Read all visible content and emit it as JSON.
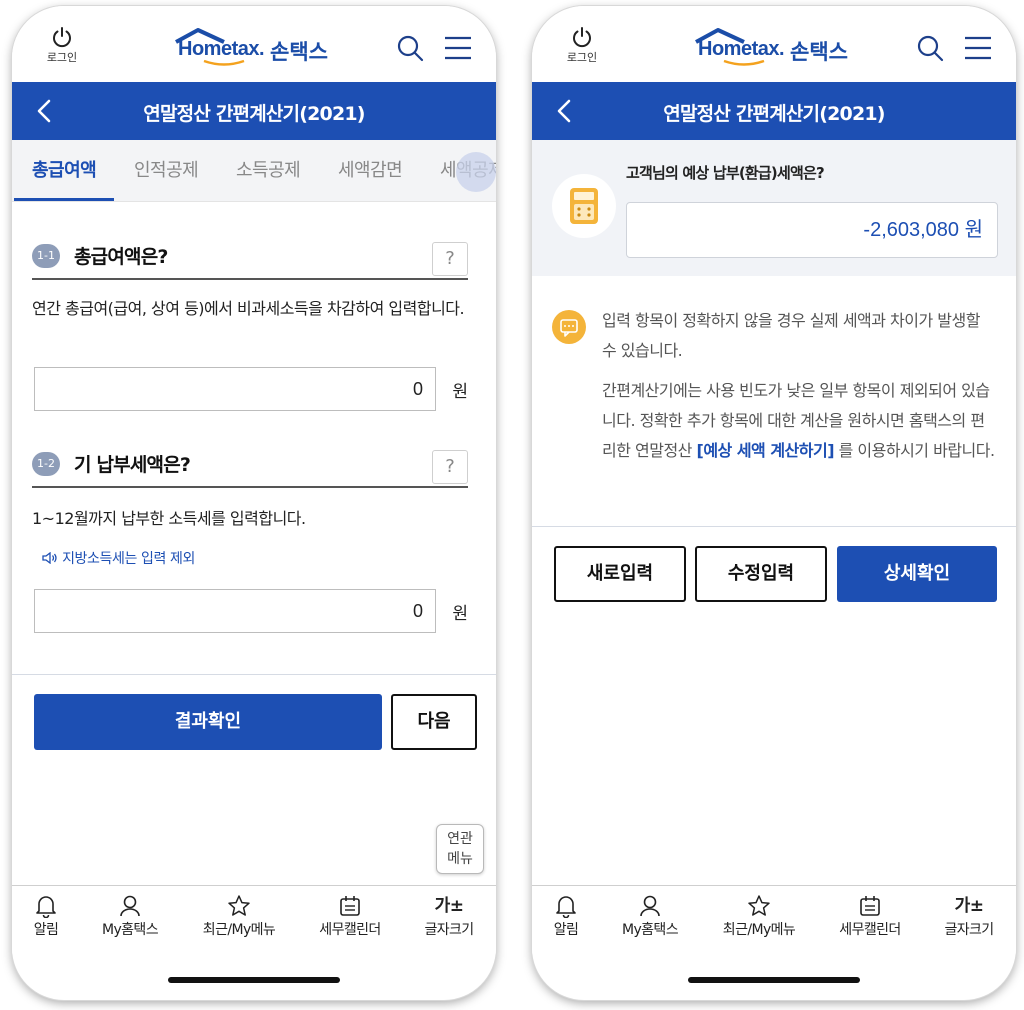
{
  "left": {
    "header": {
      "login_label": "로그인",
      "logo_main": "Hometax.",
      "logo_sub": "손택스"
    },
    "titlebar": {
      "title": "연말정산 간편계산기(2021)"
    },
    "tabs": [
      "총급여액",
      "인적공제",
      "소득공제",
      "세액감면",
      "세액공제"
    ],
    "section1": {
      "badge": "1-1",
      "title": "총급여액은?",
      "help": "?",
      "description": "연간 총급여(급여, 상여 등)에서 비과세소득을 차감하여 입력합니다.",
      "value": "0",
      "unit": "원"
    },
    "section2": {
      "badge": "1-2",
      "title": "기 납부세액은?",
      "help": "?",
      "description": "1~12월까지 납부한 소득세를 입력합니다.",
      "note": "지방소득세는 입력 제외",
      "value": "0",
      "unit": "원"
    },
    "actions": {
      "confirm": "결과확인",
      "next": "다음"
    },
    "related_menu": {
      "line1": "연관",
      "line2": "메뉴"
    }
  },
  "right": {
    "header": {
      "login_label": "로그인",
      "logo_main": "Hometax.",
      "logo_sub": "손택스"
    },
    "titlebar": {
      "title": "연말정산 간편계산기(2021)"
    },
    "result": {
      "label": "고객님의 예상 납부(환급)세액은?",
      "value": "-2,603,080 원"
    },
    "info": {
      "para1": "입력 항목이 정확하지 않을 경우 실제 세액과 차이가 발생할 수 있습니다.",
      "para2_before": "간편계산기에는 사용 빈도가 낮은 일부 항목이 제외되어 있습니다. 정확한 추가 항목에 대한 계산을 원하시면 홈택스의 편리한 연말정산 ",
      "para2_link": "[예상 세액 계산하기]",
      "para2_after": " 를 이용하시기 바랍니다."
    },
    "actions": {
      "new": "새로입력",
      "edit": "수정입력",
      "detail": "상세확인"
    }
  },
  "bottom_nav": {
    "items": [
      "알림",
      "My홈택스",
      "최근/My메뉴",
      "세무캘린더",
      "글자크기"
    ],
    "font_size_glyph": "가±"
  },
  "colors": {
    "primary": "#1d4fb3",
    "accent": "#f4b43a",
    "badge": "#8e9db8"
  },
  "icons": [
    "power-icon",
    "search-icon",
    "hamburger-menu-icon",
    "back-arrow-icon",
    "bell-icon",
    "user-icon",
    "star-icon",
    "calendar-icon",
    "calculator-icon",
    "chat-bubble-icon",
    "speaker-icon"
  ]
}
